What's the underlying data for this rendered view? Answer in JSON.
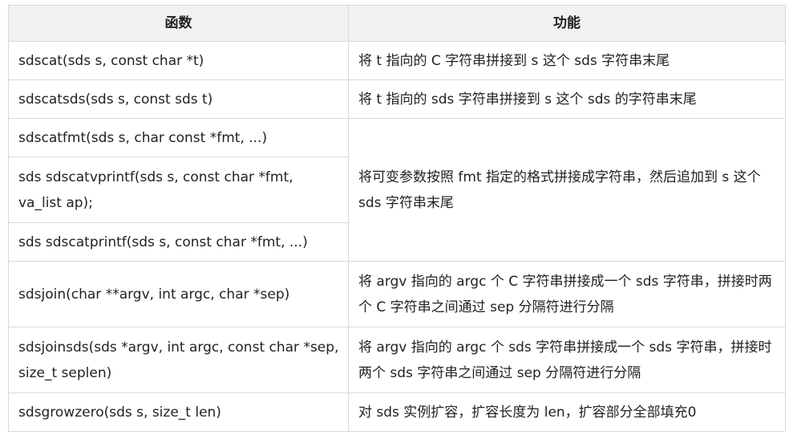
{
  "table": {
    "headers": [
      "函数",
      "功能"
    ],
    "rows": [
      {
        "func": "sdscat(sds s, const char *t)",
        "desc": "将 t 指向的 C 字符串拼接到 s 这个 sds 字符串末尾"
      },
      {
        "func": "sdscatsds(sds s, const sds t)",
        "desc": "将 t 指向的 sds 字符串拼接到 s 这个 sds 的字符串末尾"
      },
      {
        "func": "sdscatfmt(sds s, char const *fmt, ...)",
        "desc": "将可变参数按照 fmt 指定的格式拼接成字符串，然后追加到 s 这个 sds 字符串末尾"
      },
      {
        "func": "sds sdscatvprintf(sds s, const char *fmt, va_list ap);"
      },
      {
        "func": "sds sdscatprintf(sds s, const char *fmt, ...)"
      },
      {
        "func": "sdsjoin(char **argv, int argc, char *sep)",
        "desc": "将 argv 指向的 argc 个 C 字符串拼接成一个 sds 字符串，拼接时两个 C 字符串之间通过 sep 分隔符进行分隔"
      },
      {
        "func": "sdsjoinsds(sds *argv, int argc, const char *sep, size_t seplen)",
        "desc": "将 argv 指向的 argc 个 sds 字符串拼接成一个 sds 字符串，拼接时两个 sds 字符串之间通过 sep 分隔符进行分隔"
      },
      {
        "func": "sdsgrowzero(sds s, size_t len)",
        "desc": "对 sds 实例扩容，扩容长度为 len，扩容部分全部填充0"
      }
    ]
  }
}
